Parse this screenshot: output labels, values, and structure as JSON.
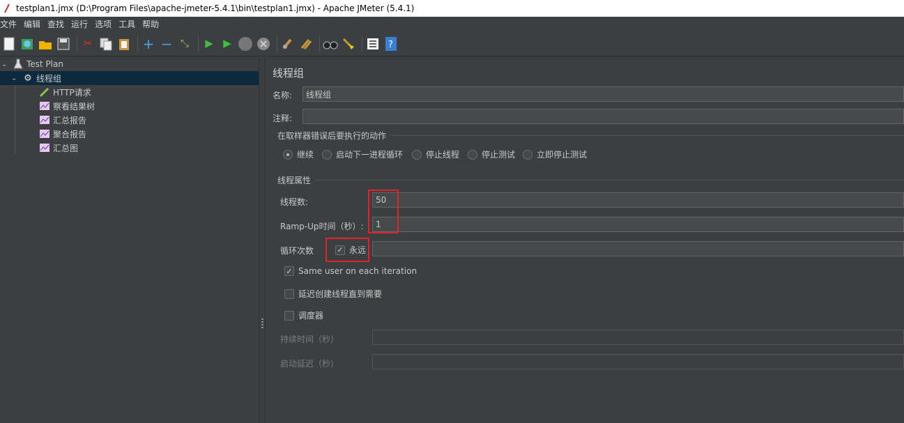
{
  "window": {
    "title": "testplan1.jmx (D:\\Program Files\\apache-jmeter-5.4.1\\bin\\testplan1.jmx) - Apache JMeter (5.4.1)"
  },
  "menu": [
    "文件",
    "编辑",
    "查找",
    "运行",
    "选项",
    "工具",
    "帮助"
  ],
  "toolbar": [
    {
      "name": "new",
      "icon": "new-icon"
    },
    {
      "name": "templates",
      "icon": "templates-icon"
    },
    {
      "name": "open",
      "icon": "open-icon"
    },
    {
      "name": "save",
      "icon": "save-icon"
    },
    {
      "name": "cut",
      "icon": "cut-icon"
    },
    {
      "name": "copy",
      "icon": "copy-icon"
    },
    {
      "name": "paste",
      "icon": "paste-icon"
    },
    {
      "name": "expand",
      "icon": "plus-icon"
    },
    {
      "name": "collapse",
      "icon": "minus-icon"
    },
    {
      "name": "toggle",
      "icon": "toggle-icon"
    },
    {
      "name": "start",
      "icon": "play-icon"
    },
    {
      "name": "start-no-pause",
      "icon": "play-no-pause-icon"
    },
    {
      "name": "stop",
      "icon": "stop-icon"
    },
    {
      "name": "shutdown",
      "icon": "shutdown-icon"
    },
    {
      "name": "clear",
      "icon": "clear-icon"
    },
    {
      "name": "clear-all",
      "icon": "clear-all-icon"
    },
    {
      "name": "search",
      "icon": "binoculars-icon"
    },
    {
      "name": "reset-search",
      "icon": "broom-icon"
    },
    {
      "name": "function-helper",
      "icon": "function-list-icon"
    },
    {
      "name": "help",
      "icon": "help-icon"
    }
  ],
  "tree": {
    "test_plan": "Test Plan",
    "thread_group": "线程组",
    "children": [
      "HTTP请求",
      "察看结果树",
      "汇总报告",
      "聚合报告",
      "汇总图"
    ]
  },
  "panel": {
    "title": "线程组",
    "name_label": "名称:",
    "name_value": "线程组",
    "comment_label": "注释:",
    "comment_value": "",
    "error_action_title": "在取样器错误后要执行的动作",
    "error_actions": [
      "继续",
      "启动下一进程循环",
      "停止线程",
      "停止测试",
      "立即停止测试"
    ],
    "error_action_selected": "继续",
    "thread_props_title": "线程属性",
    "threads_label": "线程数:",
    "threads_value": "50",
    "rampup_label": "Ramp-Up时间（秒）:",
    "rampup_value": "1",
    "loop_label": "循环次数",
    "forever_label": "永远",
    "forever_checked": true,
    "loop_value": "",
    "same_user_label": "Same user on each iteration",
    "same_user_checked": true,
    "delay_label": "延迟创建线程直到需要",
    "delay_checked": false,
    "scheduler_label": "调度器",
    "scheduler_checked": false,
    "duration_label": "持续时间（秒）",
    "duration_value": "",
    "startup_delay_label": "启动延迟（秒）",
    "startup_delay_value": ""
  },
  "colors": {
    "background": "#3c3f41",
    "selection": "#0d293e",
    "highlight_box": "#e3232a"
  }
}
